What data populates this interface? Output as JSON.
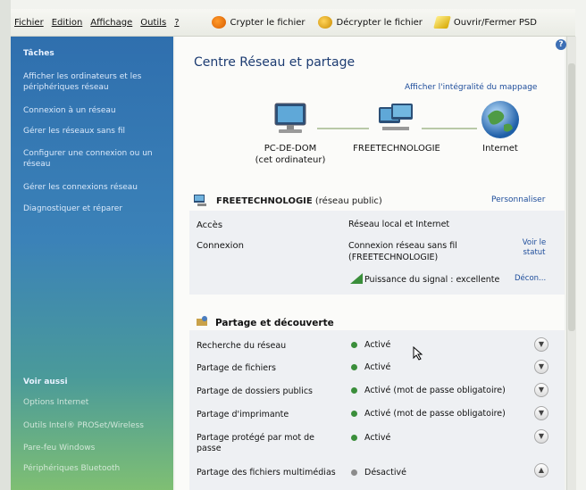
{
  "menu": {
    "items": [
      "Fichier",
      "Edition",
      "Affichage",
      "Outils",
      "?"
    ],
    "toolbar": {
      "encrypt": "Crypter le fichier",
      "decrypt": "Décrypter le fichier",
      "psd": "Ouvrir/Fermer PSD"
    }
  },
  "sidebar": {
    "title": "Tâches",
    "tasks": [
      "Afficher les ordinateurs et les périphériques réseau",
      "Connexion à un réseau",
      "Gérer les réseaux sans fil",
      "Configurer une connexion ou un réseau",
      "Gérer les connexions réseau",
      "Diagnostiquer et réparer"
    ],
    "see_also_title": "Voir aussi",
    "see_also": [
      "Options Internet",
      "Outils Intel® PROSet/Wireless",
      "Pare-feu Windows",
      "Périphériques Bluetooth"
    ]
  },
  "main": {
    "title": "Centre Réseau et partage",
    "map_link": "Afficher l'intégralité du mappage",
    "nodes": {
      "computer": "PC-DE-DOM",
      "computer_sub": "(cet ordinateur)",
      "network": "FREETECHNOLOGIE",
      "internet": "Internet"
    },
    "network": {
      "name": "FREETECHNOLOGIE",
      "type": "(réseau public)",
      "customize": "Personnaliser",
      "access_label": "Accès",
      "access_value": "Réseau local et Internet",
      "connection_label": "Connexion",
      "connection_value_1": "Connexion réseau sans fil",
      "connection_value_2": "(FREETECHNOLOGIE)",
      "status_link_1": "Voir le",
      "status_link_2": "statut",
      "signal": "Puissance du signal : excellente",
      "disconnect": "Décon..."
    },
    "sharing": {
      "title": "Partage et découverte",
      "rows": [
        {
          "label": "Recherche du réseau",
          "status": "Activé"
        },
        {
          "label": "Partage de fichiers",
          "status": "Activé"
        },
        {
          "label": "Partage de dossiers publics",
          "status": "Activé (mot de passe obligatoire)"
        },
        {
          "label": "Partage d'imprimante",
          "status": "Activé (mot de passe obligatoire)"
        },
        {
          "label": "Partage protégé par mot de passe",
          "status": "Activé"
        },
        {
          "label": "Partage des fichiers multimédias",
          "status": "Désactivé"
        }
      ]
    }
  },
  "colors": {
    "link": "#1e4d9b",
    "title": "#1d3c72",
    "active_dot": "#3a8e3a"
  }
}
